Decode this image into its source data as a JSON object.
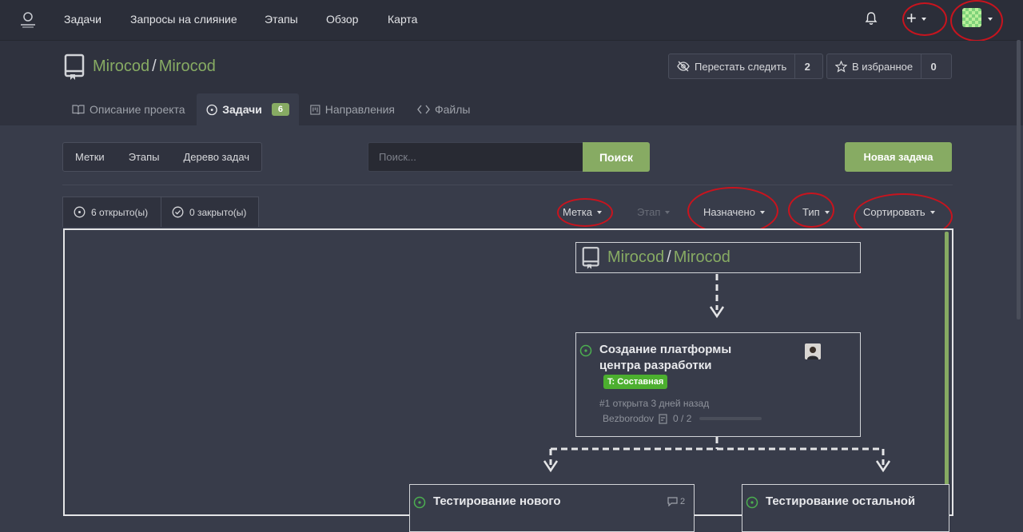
{
  "topnav": {
    "links": [
      "Задачи",
      "Запросы на слияние",
      "Этапы",
      "Обзор",
      "Карта"
    ]
  },
  "repo": {
    "owner": "Mirocod",
    "name": "Mirocod",
    "unwatch_label": "Перестать следить",
    "watch_count": "2",
    "star_label": "В избранное",
    "star_count": "0"
  },
  "tabs": [
    {
      "label": "Описание проекта"
    },
    {
      "label": "Задачи",
      "badge": "6"
    },
    {
      "label": "Направления"
    },
    {
      "label": "Файлы"
    }
  ],
  "toolbar": {
    "groups": [
      "Метки",
      "Этапы",
      "Дерево задач"
    ],
    "search_placeholder": "Поиск...",
    "search_button": "Поиск",
    "new_issue": "Новая задача"
  },
  "states": {
    "open": "6 открыто(ы)",
    "closed": "0 закрыто(ы)"
  },
  "filters": {
    "label": "Метка",
    "milestone": "Этап",
    "assignee": "Назначено",
    "type": "Тип",
    "sort": "Сортировать"
  },
  "tree": {
    "root_owner": "Mirocod",
    "root_name": "Mirocod",
    "issue1": {
      "title_line1": "Создание платформы",
      "title_line2": "центра разработки",
      "label": "T: Составная",
      "meta": "#1 открыта 3 дней назад",
      "author": "Bezborodov",
      "tasks": "0 / 2"
    },
    "issue2": {
      "title": "Тестирование нового",
      "comments": "2"
    },
    "issue3": {
      "title": "Тестирование остальной"
    }
  },
  "colors": {
    "accent": "#87ab63",
    "annotation": "#c8141e",
    "label_green": "#4caf2f"
  }
}
